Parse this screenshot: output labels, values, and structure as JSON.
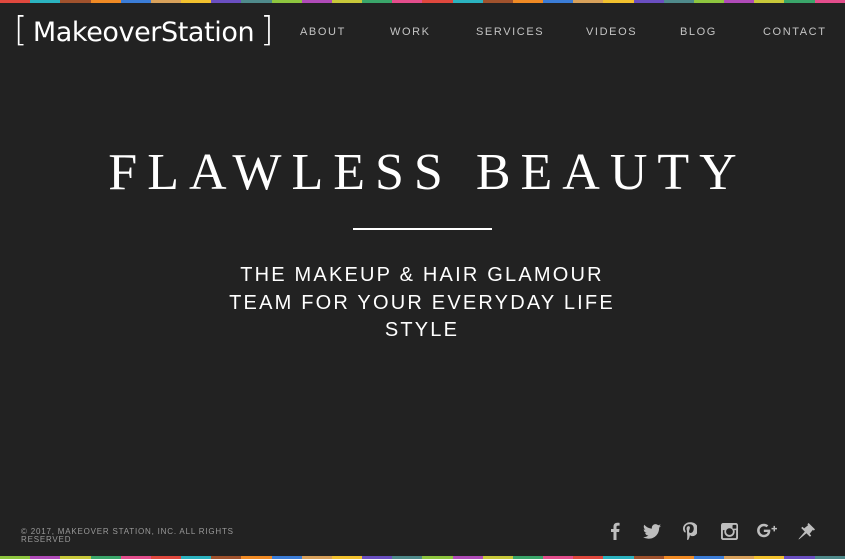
{
  "brand": {
    "bracket_open": "[",
    "name": "MakeoverStation",
    "bracket_close": "]"
  },
  "nav": {
    "items": [
      {
        "label": "ABOUT"
      },
      {
        "label": "WORK"
      },
      {
        "label": "SERVICES"
      },
      {
        "label": "VIDEOS"
      },
      {
        "label": "BLOG"
      },
      {
        "label": "CONTACT"
      }
    ]
  },
  "hero": {
    "title": "FLAWLESS BEAUTY",
    "tagline": "THE MAKEUP & HAIR GLAMOUR TEAM FOR YOUR EVERYDAY LIFE STYLE"
  },
  "footer": {
    "copyright": "© 2017, MAKEOVER STATION, INC. ALL RIGHTS RESERVED"
  },
  "social": [
    {
      "icon": "facebook-icon"
    },
    {
      "icon": "twitter-icon"
    },
    {
      "icon": "pinterest-icon"
    },
    {
      "icon": "instagram-icon"
    },
    {
      "icon": "google-plus-icon"
    },
    {
      "icon": "pin-icon"
    }
  ],
  "colors": {
    "background": "#222222",
    "text": "#ffffff",
    "nav_text": "#c4c4c4",
    "footer_text": "#9a9a9a",
    "icon": "#bdbdbd",
    "stripe": [
      "#e0483e",
      "#f08a24",
      "#f2c12e",
      "#8ec63f",
      "#3aa66a",
      "#2bb3c0",
      "#3b7dd8",
      "#6a4fc1",
      "#b04bb8",
      "#e34d8c",
      "#a0522d",
      "#d8a15b",
      "#4f8a8b",
      "#c8c83a"
    ]
  }
}
